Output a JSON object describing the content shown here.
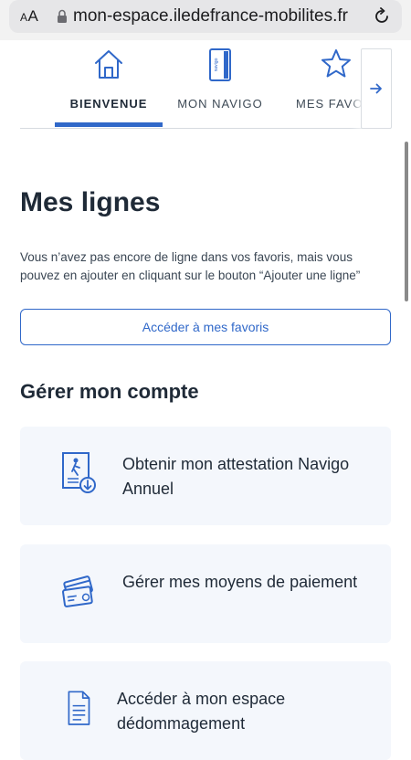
{
  "browser": {
    "aa_label_small": "A",
    "aa_label_large": "A",
    "url": "mon-espace.iledefrance-mobilites.fr"
  },
  "tabs": [
    {
      "label": "BIENVENUE",
      "icon": "home-icon",
      "active": true
    },
    {
      "label": "MON NAVIGO",
      "icon": "navigo-card-icon",
      "active": false
    },
    {
      "label": "MES FAVO",
      "icon": "star-icon",
      "active": false
    }
  ],
  "navigo_card_text": "navigo",
  "main": {
    "title": "Mes lignes",
    "description": "Vous n’avez pas encore de ligne dans vos favoris, mais vous pouvez en ajouter en cliquant sur le bouton “Ajouter une ligne”",
    "favorites_button": "Accéder à mes favoris",
    "section_title": "Gérer mon compte",
    "cards": [
      {
        "label": "Obtenir mon attestation Navigo Annuel",
        "icon": "attestation-document-icon"
      },
      {
        "label": "Gérer mes moyens de paiement",
        "icon": "payment-cards-icon"
      },
      {
        "label": "Accéder à mon espace dédommagement",
        "icon": "document-icon"
      }
    ]
  },
  "colors": {
    "accent": "#3068c9",
    "card_background": "#f4f7fc",
    "text_dark": "#1f2a37"
  }
}
